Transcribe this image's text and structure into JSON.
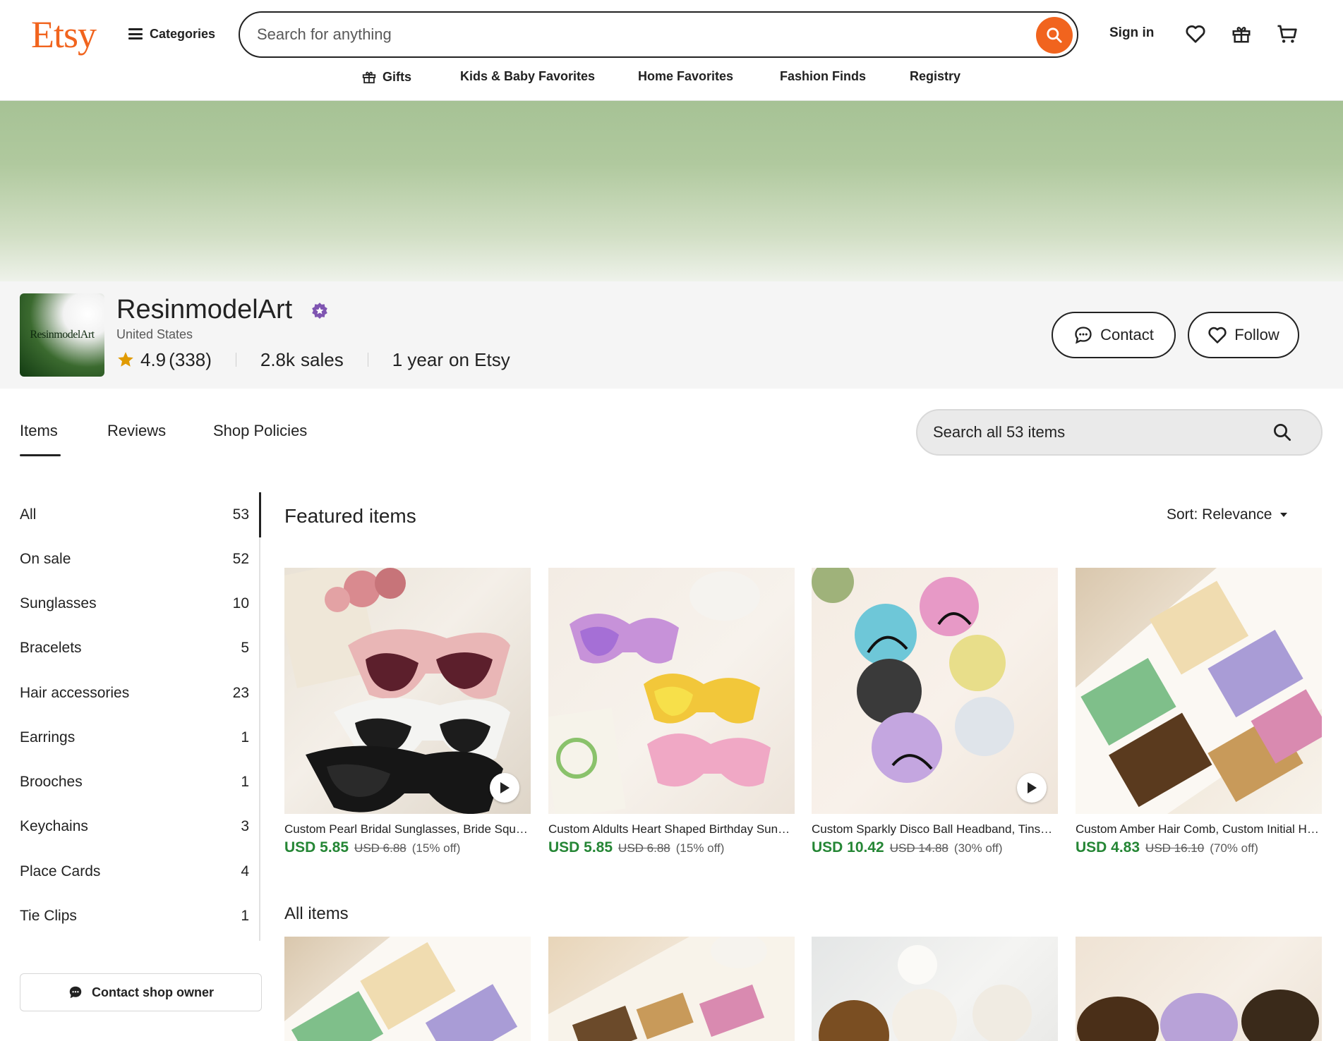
{
  "header": {
    "logo": "Etsy",
    "categories_label": "Categories",
    "search_placeholder": "Search for anything",
    "sign_in": "Sign in"
  },
  "subnav": [
    "Gifts",
    "Kids & Baby Favorites",
    "Home Favorites",
    "Fashion Finds",
    "Registry"
  ],
  "shop": {
    "logo_text": "ResinmodelArt",
    "name": "ResinmodelArt",
    "location": "United States",
    "rating": "4.9",
    "review_count": "(338)",
    "sales_num": "2.8k",
    "sales_label": "sales",
    "years_num": "1 year",
    "years_label": "on Etsy",
    "contact_label": "Contact",
    "follow_label": "Follow"
  },
  "tabs": [
    "Items",
    "Reviews",
    "Shop Policies"
  ],
  "shop_search_placeholder": "Search all 53 items",
  "sidebar": {
    "items": [
      {
        "label": "All",
        "count": "53"
      },
      {
        "label": "On sale",
        "count": "52"
      },
      {
        "label": "Sunglasses",
        "count": "10"
      },
      {
        "label": "Bracelets",
        "count": "5"
      },
      {
        "label": "Hair accessories",
        "count": "23"
      },
      {
        "label": "Earrings",
        "count": "1"
      },
      {
        "label": "Brooches",
        "count": "1"
      },
      {
        "label": "Keychains",
        "count": "3"
      },
      {
        "label": "Place Cards",
        "count": "4"
      },
      {
        "label": "Tie Clips",
        "count": "1"
      }
    ],
    "contact_owner": "Contact shop owner"
  },
  "main": {
    "featured_title": "Featured items",
    "sort_label": "Sort: Relevance",
    "all_items_title": "All items",
    "featured": [
      {
        "title": "Custom Pearl Bridal Sunglasses, Bride Squad Sunglasses, Hen Party",
        "price": "USD 5.85",
        "original": "USD 6.88",
        "discount": "(15% off)"
      },
      {
        "title": "Custom Aldults Heart Shaped Birthday Sunglasses, Party Sunglasses",
        "price": "USD 5.85",
        "original": "USD 6.88",
        "discount": "(15% off)"
      },
      {
        "title": "Custom Sparkly Disco Ball Headband, Tinsel Party Headband",
        "price": "USD 10.42",
        "original": "USD 14.88",
        "discount": "(30% off)"
      },
      {
        "title": "Custom Amber Hair Comb, Custom Initial Hair Comb, Bridesmaid Gift",
        "price": "USD 4.83",
        "original": "USD 16.10",
        "discount": "(70% off)"
      }
    ]
  },
  "colors": {
    "brand": "#F1641E",
    "sale_price": "#258635",
    "badge": "#7F55B1",
    "star": "#E09A00"
  }
}
